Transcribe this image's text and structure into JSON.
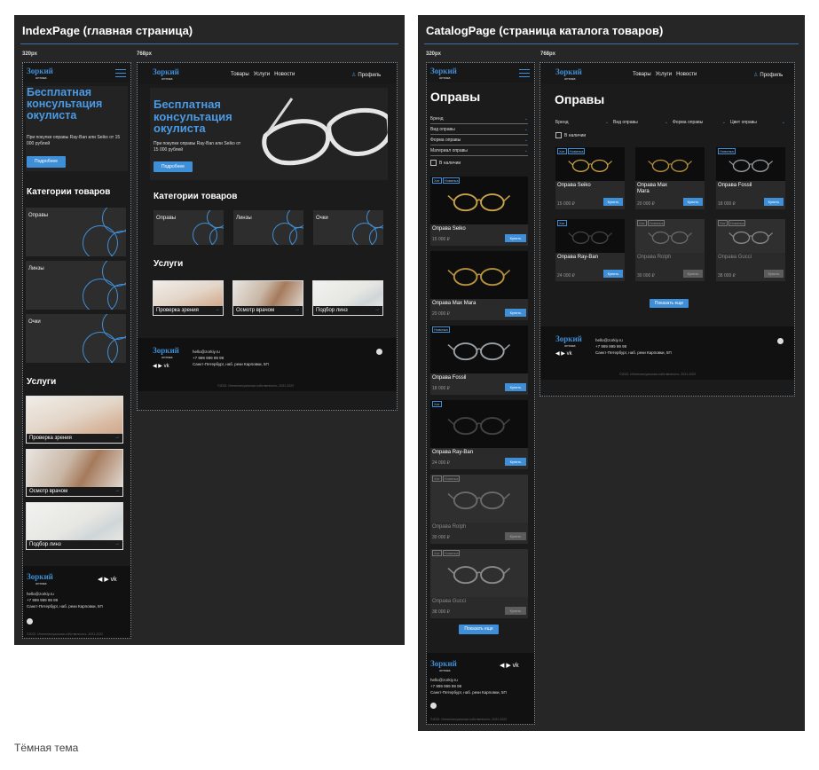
{
  "boards": {
    "index": {
      "title": "IndexPage (главная страница)"
    },
    "catalog": {
      "title": "CatalogPage (страница каталога товаров)"
    }
  },
  "breakpoints": {
    "mobile": "320px",
    "tablet": "768px"
  },
  "brand": {
    "name": "Зоркий",
    "sub": "оптика",
    "accent": "#3f8fd8"
  },
  "nav": {
    "items": [
      "Товары",
      "Услуги",
      "Новости"
    ],
    "profile": "Профиль"
  },
  "hero": {
    "title": "Бесплатная консультация окулиста",
    "text": "При покупке оправы Ray-Ban или Seiko от 15 000 рублей",
    "button": "Подробнее"
  },
  "categories": {
    "title": "Категории товаров",
    "items": [
      "Оправы",
      "Линзы",
      "Очки"
    ]
  },
  "services": {
    "title": "Услуги",
    "items": [
      "Проверка зрения",
      "Осмотр врачом",
      "Подбор линз"
    ],
    "arrow": "→"
  },
  "footer": {
    "email": "hello@zorkiy.ru",
    "phone": "+7 999 999 99 99",
    "address": "Санкт-Петербург, наб. реки Карповки, 5П",
    "copyright": "©2022. Интеллектуальная собственность. 2021-2022",
    "social": "◀ ▶ vk"
  },
  "catalog": {
    "title": "Оправы",
    "filters": [
      "Бренд",
      "Вид оправы",
      "Форма оправы",
      "Материал оправы"
    ],
    "filters_tablet": [
      "Бренд",
      "Вид оправы",
      "Форма оправы",
      "Цвет оправы"
    ],
    "in_stock": "В наличии",
    "more": "Показать еще",
    "buy": "Купить",
    "products": [
      {
        "name": "Оправа Seiko",
        "price": "15 000 ₽",
        "tags": [
          "Хит",
          "Новинка"
        ],
        "available": true
      },
      {
        "name": "Оправа Max Mara",
        "price": "20 000 ₽",
        "tags": [],
        "available": true
      },
      {
        "name": "Оправа Fossil",
        "price": "18 000 ₽",
        "tags": [
          "Новинка"
        ],
        "available": true
      },
      {
        "name": "Оправа Ray-Ban",
        "price": "24 000 ₽",
        "tags": [
          "Хит"
        ],
        "available": true
      },
      {
        "name": "Оправа Rolph",
        "price": "30 000 ₽",
        "tags": [
          "Хит",
          "Новинка"
        ],
        "available": false
      },
      {
        "name": "Оправа Gucci",
        "price": "38 000 ₽",
        "tags": [
          "Хит",
          "Новинка"
        ],
        "available": false
      }
    ]
  },
  "caption": "Тёмная тема"
}
